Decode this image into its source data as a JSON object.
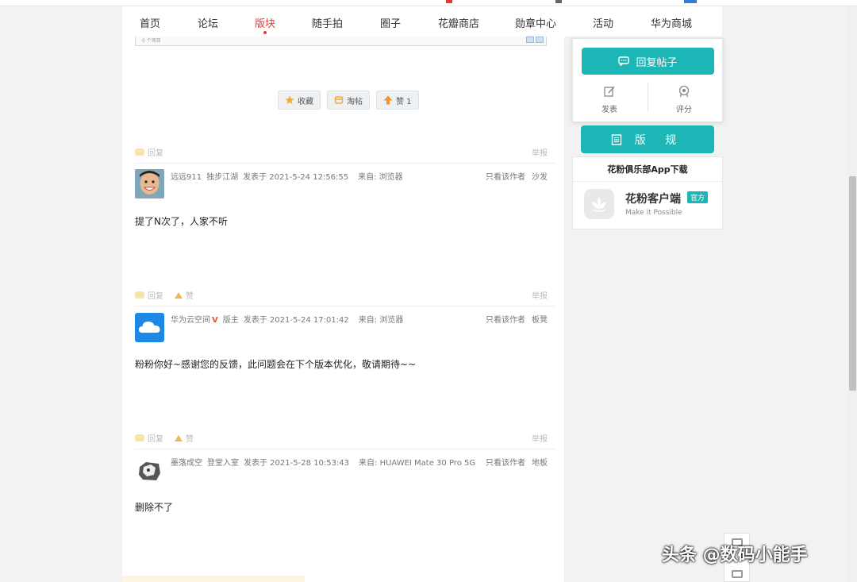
{
  "nav": {
    "items": [
      {
        "label": "首页"
      },
      {
        "label": "论坛"
      },
      {
        "label": "版块",
        "active": true
      },
      {
        "label": "随手拍"
      },
      {
        "label": "圈子"
      },
      {
        "label": "花瓣商店"
      },
      {
        "label": "勋章中心"
      },
      {
        "label": "活动"
      },
      {
        "label": "华为商城"
      }
    ]
  },
  "prev_screenshot": {
    "item_count": "0 个项目"
  },
  "actions": {
    "favorite": "收藏",
    "taotie": "淘帖",
    "like": "赞 1"
  },
  "tools": {
    "reply": "回复",
    "like": "赞",
    "report": "举报"
  },
  "posts": [
    {
      "author": "远远911",
      "rank": "独步江湖",
      "posted": "发表于 2021-5-24 12:56:55",
      "source": "来自: 浏览器",
      "author_only": "只看该作者",
      "floor": "沙发",
      "text": "提了N次了，人家不听"
    },
    {
      "author": "华为云空间",
      "badge": "V",
      "rank": "版主",
      "posted": "发表于 2021-5-24 17:01:42",
      "source": "来自: 浏览器",
      "author_only": "只看该作者",
      "floor": "板凳",
      "text": "粉粉你好~感谢您的反馈，此问题会在下个版本优化，敬请期待~~"
    },
    {
      "author": "墨落成空",
      "rank": "登堂入室",
      "posted": "发表于 2021-5-28 10:53:43",
      "source": "来自: HUAWEI Mate 30 Pro 5G",
      "author_only": "只看该作者",
      "floor": "地板",
      "text": "删除不了"
    }
  ],
  "sidebar": {
    "reply_button": "回复帖子",
    "post_button": "发表",
    "rate_button": "评分",
    "rules_button": "版 规",
    "app_section_title": "花粉俱乐部App下载",
    "app_name": "花粉客户端",
    "app_badge": "官方",
    "app_slogan": "Make it Possible"
  },
  "watermark": "头条 @数码小能手",
  "colors": {
    "accent": "#1db6b6",
    "active_nav": "#e13a3a"
  }
}
